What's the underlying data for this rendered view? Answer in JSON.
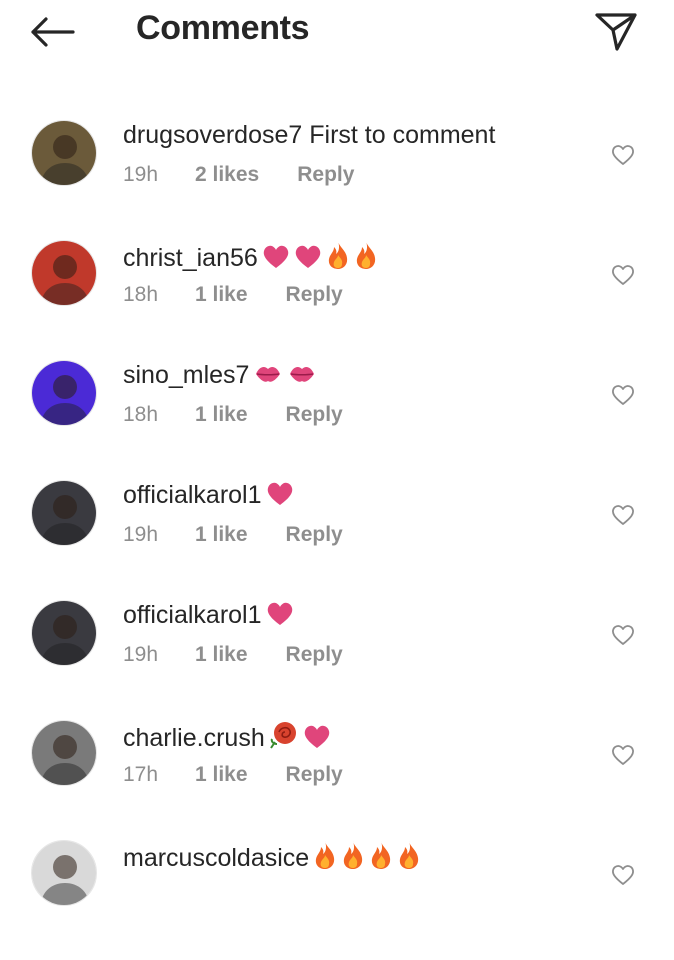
{
  "header": {
    "title": "Comments",
    "back_icon": "arrow-left-icon",
    "share_icon": "paper-plane-icon"
  },
  "comments": [
    {
      "username": "drugsoverdose7",
      "text": "First to comment",
      "emojis": [],
      "time": "19h",
      "likes": "2 likes",
      "reply": "Reply",
      "avatar_color": "#6b5a3a"
    },
    {
      "username": "christ_ian56",
      "text": "",
      "emojis": [
        "heart",
        "heart",
        "fire",
        "fire"
      ],
      "time": "18h",
      "likes": "1 like",
      "reply": "Reply",
      "avatar_color": "#c0392b"
    },
    {
      "username": "sino_mles7",
      "text": "",
      "emojis": [
        "kiss",
        "kiss"
      ],
      "time": "18h",
      "likes": "1 like",
      "reply": "Reply",
      "avatar_color": "#4b2ad6"
    },
    {
      "username": "officialkarol1",
      "text": "",
      "emojis": [
        "heart"
      ],
      "time": "19h",
      "likes": "1 like",
      "reply": "Reply",
      "avatar_color": "#3a3a40"
    },
    {
      "username": "officialkarol1",
      "text": "",
      "emojis": [
        "heart"
      ],
      "time": "19h",
      "likes": "1 like",
      "reply": "Reply",
      "avatar_color": "#3a3a40"
    },
    {
      "username": "charlie.crush",
      "text": "",
      "emojis": [
        "rose",
        "heart"
      ],
      "time": "17h",
      "likes": "1 like",
      "reply": "Reply",
      "avatar_color": "#7a7a7a"
    },
    {
      "username": "marcuscoldasice",
      "text": "",
      "emojis": [
        "fire",
        "fire",
        "fire",
        "fire"
      ],
      "time": "",
      "likes": "",
      "reply": "",
      "avatar_color": "#d9d9d9"
    }
  ],
  "colors": {
    "text": "#262626",
    "secondary": "#8e8e8e",
    "heart_emoji": "#e0457b",
    "fire_emoji": "#f26522"
  }
}
